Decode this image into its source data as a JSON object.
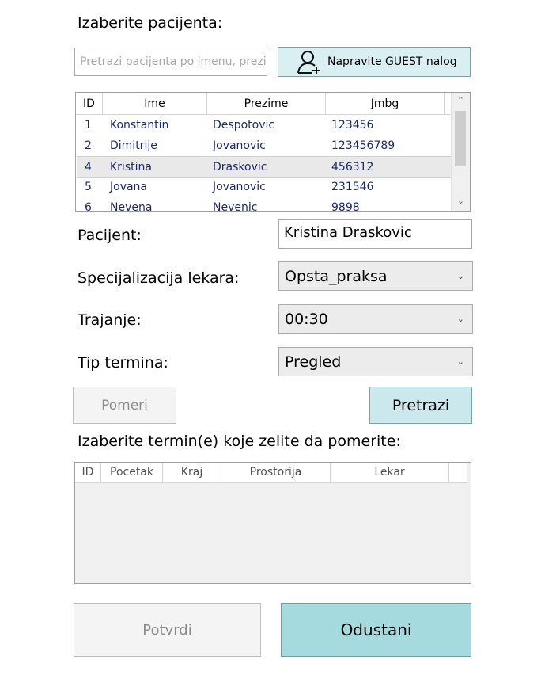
{
  "header": {
    "select_patient_label": "Izaberite pacijenta:"
  },
  "search": {
    "placeholder": "Pretrazi pacijenta po imenu, prezime"
  },
  "guest_button": {
    "label": "Napravite GUEST nalog",
    "icon": "add-user-icon"
  },
  "patients_table": {
    "columns": [
      "ID",
      "Ime",
      "Prezime",
      "Jmbg"
    ],
    "rows": [
      {
        "id": "1",
        "ime": "Konstantin",
        "prezime": "Despotovic",
        "jmbg": "123456"
      },
      {
        "id": "2",
        "ime": "Dimitrije",
        "prezime": "Jovanovic",
        "jmbg": "123456789"
      },
      {
        "id": "4",
        "ime": "Kristina",
        "prezime": "Draskovic",
        "jmbg": "456312"
      },
      {
        "id": "5",
        "ime": "Jovana",
        "prezime": "Jovanovic",
        "jmbg": "231546"
      },
      {
        "id": "6",
        "ime": "Nevena",
        "prezime": "Nevenic",
        "jmbg": "9898"
      }
    ],
    "selected_row_index": 2,
    "scroll_up_icon": "chevron-up-icon",
    "scroll_down_icon": "chevron-down-icon"
  },
  "form": {
    "patient_label": "Pacijent:",
    "patient_value": "Kristina Draskovic",
    "specialization_label": "Specijalizacija lekara:",
    "specialization_value": "Opsta_praksa",
    "duration_label": "Trajanje:",
    "duration_value": "00:30",
    "type_label": "Tip termina:",
    "type_value": "Pregled",
    "dropdown_icon": "chevron-down-icon"
  },
  "actions": {
    "move_label": "Pomeri",
    "search_label": "Pretrazi"
  },
  "terms": {
    "label": "Izaberite termin(e) koje zelite da pomerite:",
    "columns": [
      "ID",
      "Pocetak",
      "Kraj",
      "Prostorija",
      "Lekar"
    ]
  },
  "footer": {
    "confirm_label": "Potvrdi",
    "cancel_label": "Odustani"
  },
  "colors": {
    "accent_button": "#cbe8ec",
    "accent_button_strong": "#a5dade",
    "row_text": "#1b2a6b",
    "disabled_text": "#8c8c8c"
  }
}
